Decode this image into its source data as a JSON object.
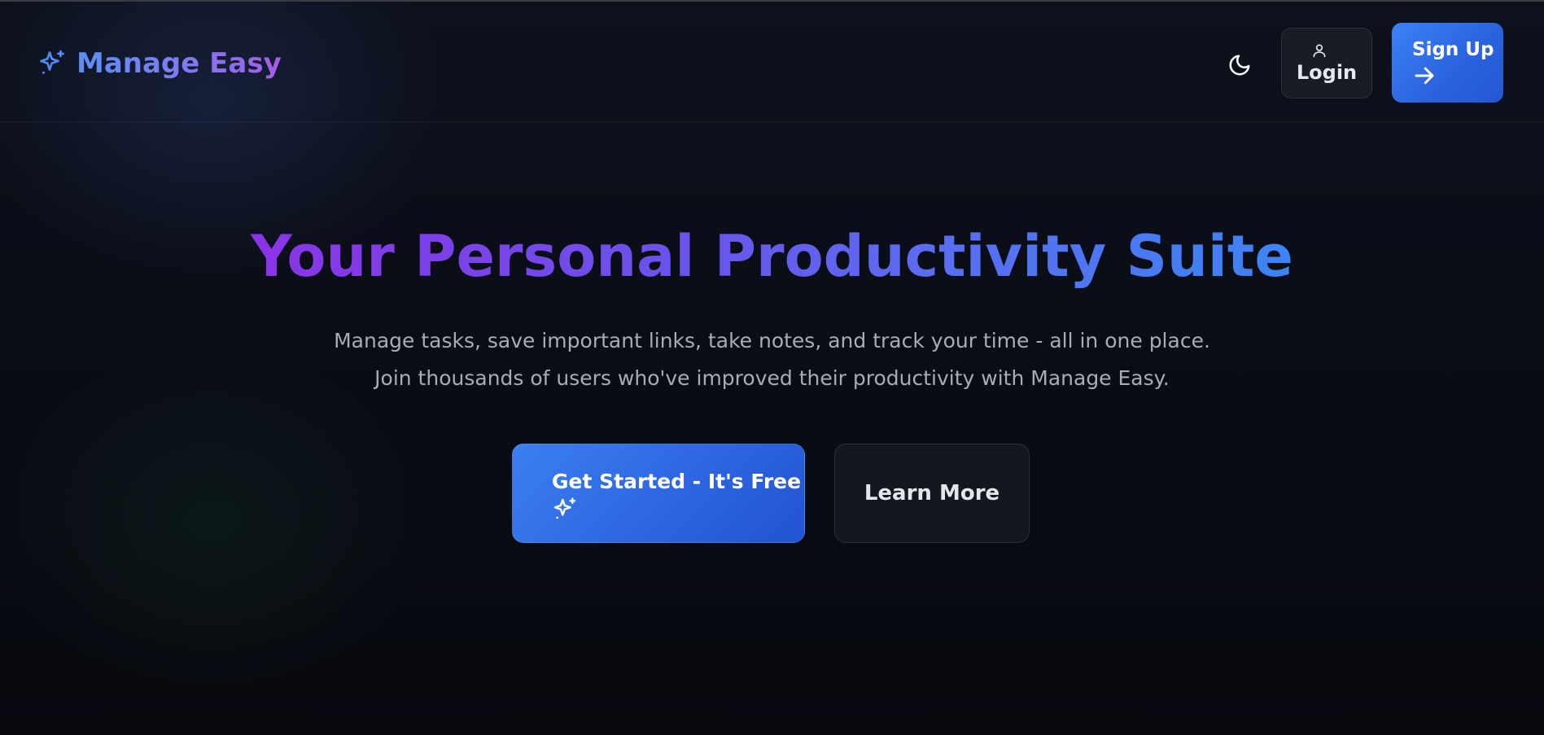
{
  "header": {
    "brand_name": "Manage Easy",
    "brand_icon": "sparkles-icon",
    "theme_toggle_icon": "moon-icon",
    "login_label": "Login",
    "login_icon": "user-icon",
    "signup_label": "Sign Up",
    "signup_icon": "arrow-right-icon"
  },
  "hero": {
    "title": "Your Personal Productivity Suite",
    "subtitle_line1": "Manage tasks, save important links, take notes, and track your time - all in one place.",
    "subtitle_line2": "Join thousands of users who've improved their productivity with Manage Easy.",
    "primary_cta_label": "Get Started - It's Free",
    "primary_cta_icon": "sparkles-icon",
    "secondary_cta_label": "Learn More"
  },
  "colors": {
    "background": "#0a0c13",
    "accent_blue": "#3b82f6",
    "accent_purple": "#8a34e6"
  }
}
